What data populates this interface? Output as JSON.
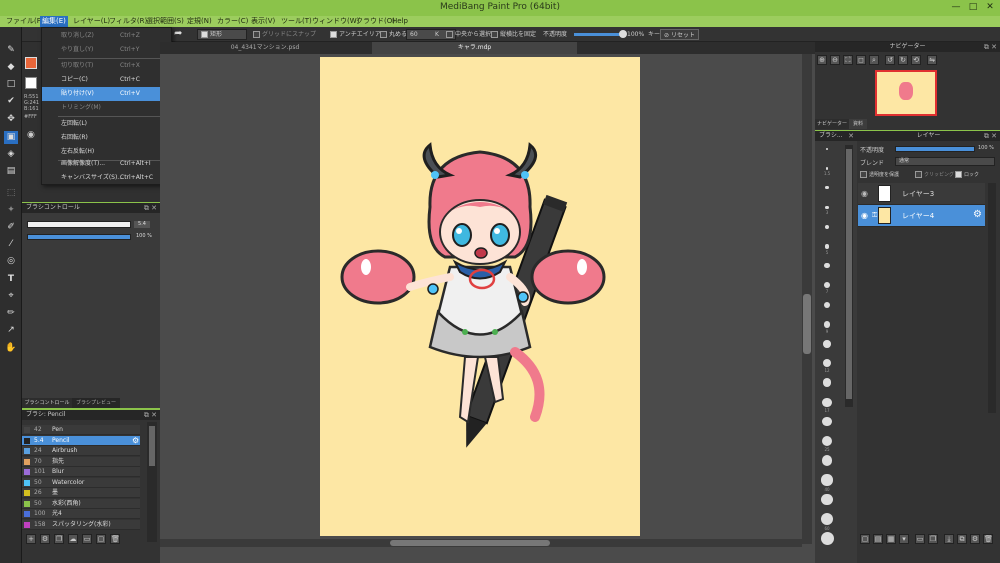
{
  "window": {
    "title": "MediBang Paint Pro (64bit)",
    "minimize": "—",
    "maximize": "□",
    "close": "✕"
  },
  "menubar": [
    "ファイル(F)",
    "編集(E)",
    "レイヤー(L)",
    "フィルタ(R)",
    "選択範囲(S)",
    "定規(N)",
    "カラー(C)",
    "表示(V)",
    "ツール(T)",
    "ウィンドウ(W)",
    "クラウド(O)",
    "Help"
  ],
  "toolbar": {
    "shape": "矩形",
    "grid_snap": "グリッドにスナップ",
    "antialias": "アンチエイリアス",
    "round": "丸める",
    "round_value": "60",
    "center_select": "中央から選択",
    "fix_ratio": "縦横比を固定",
    "opacity_label": "不透明度",
    "opacity_value": "100%",
    "key_label": "キー",
    "reset": "リセット"
  },
  "tabs": [
    "04_4341マンション.psd",
    "キャラ.mdp"
  ],
  "edit_menu": [
    {
      "label": "取り消し(Z)",
      "shortcut": "Ctrl+Z",
      "disabled": true
    },
    {
      "label": "やり直し(Y)",
      "shortcut": "Ctrl+Y",
      "disabled": true
    },
    {
      "label": "切り取り(T)",
      "shortcut": "Ctrl+X",
      "disabled": true
    },
    {
      "label": "コピー(C)",
      "shortcut": "Ctrl+C",
      "disabled": false
    },
    {
      "label": "貼り付け(V)",
      "shortcut": "Ctrl+V",
      "disabled": false,
      "highlighted": true
    },
    {
      "label": "トリミング(M)",
      "shortcut": "",
      "disabled": true
    },
    {
      "label": "左回転(L)",
      "shortcut": "",
      "disabled": false
    },
    {
      "label": "右回転(R)",
      "shortcut": "",
      "disabled": false
    },
    {
      "label": "左右反転(H)",
      "shortcut": "",
      "disabled": false
    },
    {
      "label": "画像解像度(T)...",
      "shortcut": "Ctrl+Alt+I",
      "disabled": false
    },
    {
      "label": "キャンバスサイズ(S)...",
      "shortcut": "Ctrl+Alt+C",
      "disabled": false
    }
  ],
  "color_readout": {
    "r": "R:551",
    "g": "G:241",
    "b": "B:161",
    "hex": "#FFF"
  },
  "brush_control": {
    "title": "ブラシコントロール",
    "size_value": "5.4",
    "opacity_value": "100 %",
    "size_fill": 0.88,
    "opacity_fill": 1.0,
    "tabs": [
      "ブラシコントロール",
      "ブラシプレビュー"
    ]
  },
  "brush_panel": {
    "title": "ブラシ: Pencil",
    "items": [
      {
        "num": "42",
        "name": "Pen",
        "color": "#444444"
      },
      {
        "num": "5.4",
        "name": "Pencil",
        "color": "#222222"
      },
      {
        "num": "24",
        "name": "Airbrush",
        "color": "#5aa0e0"
      },
      {
        "num": "70",
        "name": "指先",
        "color": "#e0a060"
      },
      {
        "num": "101",
        "name": "Blur",
        "color": "#9b6bd8"
      },
      {
        "num": "50",
        "name": "Watercolor",
        "color": "#4fc3f7"
      },
      {
        "num": "26",
        "name": "墨",
        "color": "#d4c020"
      },
      {
        "num": "50",
        "name": "水彩(西角)",
        "color": "#8bc34a"
      },
      {
        "num": "100",
        "name": "光4",
        "color": "#4a6fd9"
      },
      {
        "num": "158",
        "name": "スパッタリング(水彩)",
        "color": "#c040c0"
      }
    ]
  },
  "navigator": {
    "title": "ナビゲーター",
    "tabs": [
      "ナビゲーター",
      "資料"
    ]
  },
  "brush_size_panel": {
    "title": "ブラシ..."
  },
  "layers": {
    "title": "レイヤー",
    "opacity_label": "不透明度",
    "opacity_value": "100 %",
    "opacity_fill": 1.0,
    "blend_label": "ブレンド",
    "blend_value": "通常",
    "protect_alpha": "透明度を保護",
    "clipping": "クリッピング",
    "lock": "ロック",
    "items": [
      {
        "name": "レイヤー3",
        "selected": false
      },
      {
        "name": "レイヤー4",
        "selected": true
      }
    ]
  },
  "size_dots": [
    "1",
    "1.5",
    "2",
    "3",
    "4",
    "5",
    "6",
    "7",
    "8",
    "9",
    "10",
    "12",
    "15",
    "17",
    "20",
    "25",
    "30",
    "40",
    "50",
    "60",
    "70"
  ],
  "colors": {
    "accent": "#4a90d9",
    "chrome": "#8bc34a",
    "paper": "#fde7a4"
  }
}
